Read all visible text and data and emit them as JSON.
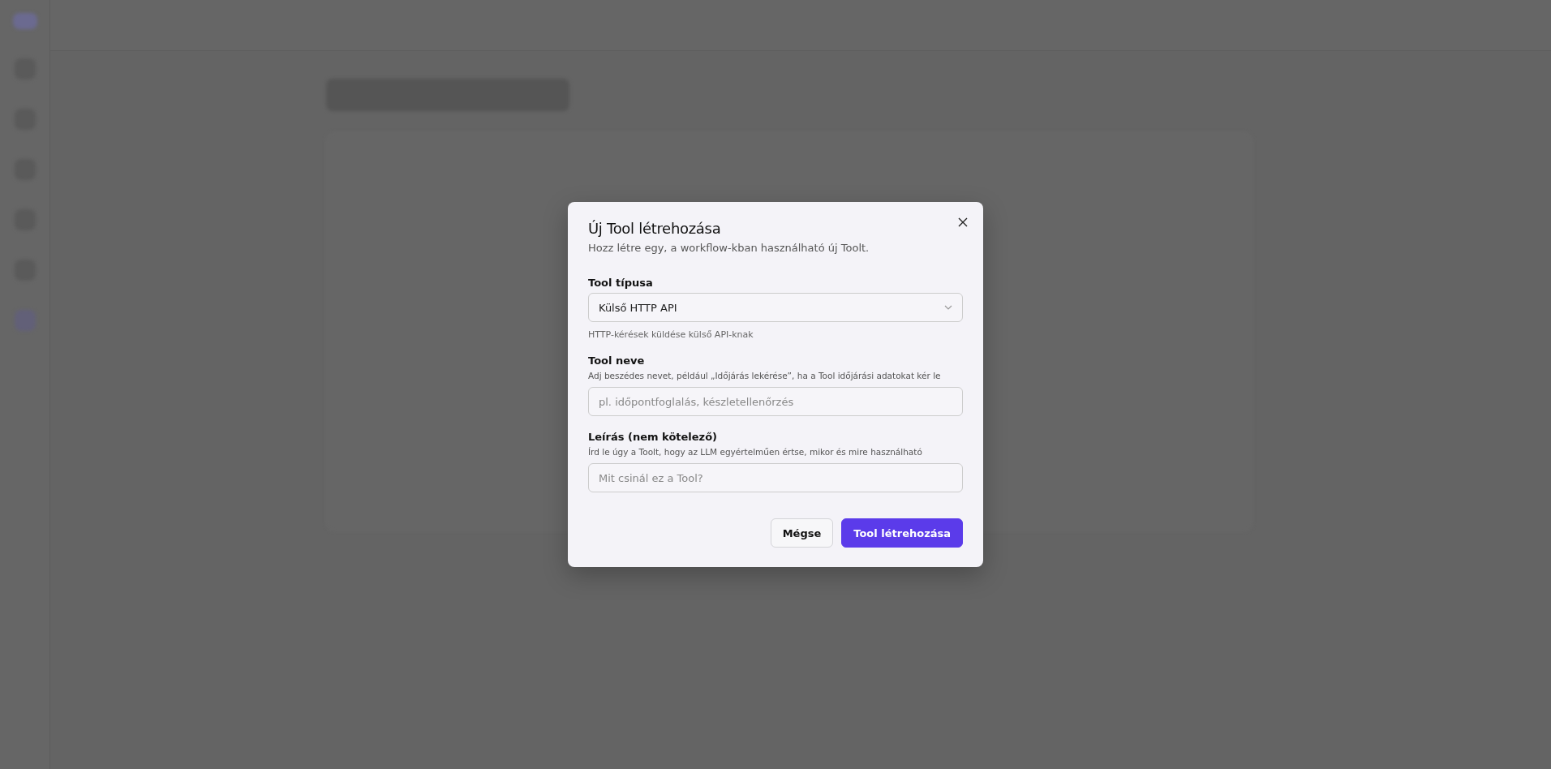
{
  "dialog": {
    "title": "Új Tool létrehozása",
    "subtitle": "Hozz létre egy, a workflow-kban használható új Toolt.",
    "fields": [
      {
        "kind": "select",
        "label": "Tool típusa",
        "value": "Külső HTTP API",
        "hint": "HTTP-kérések küldése külső API-knak"
      },
      {
        "kind": "text",
        "label": "Tool neve",
        "help": "Adj beszédes nevet, például „Időjárás lekérése”, ha a Tool időjárási adatokat kér le",
        "placeholder": "pl. időpontfoglalás, készletellenőrzés"
      },
      {
        "kind": "text",
        "label": "Leírás (nem kötelező)",
        "help": "Írd le úgy a Toolt, hogy az LLM egyértelműen értse, mikor és mire használható",
        "placeholder": "Mit csinál ez a Tool?"
      }
    ],
    "buttons": [
      {
        "label": "Mégse",
        "kind": "secondary"
      },
      {
        "label": "Tool létrehozása",
        "kind": "primary"
      }
    ]
  }
}
